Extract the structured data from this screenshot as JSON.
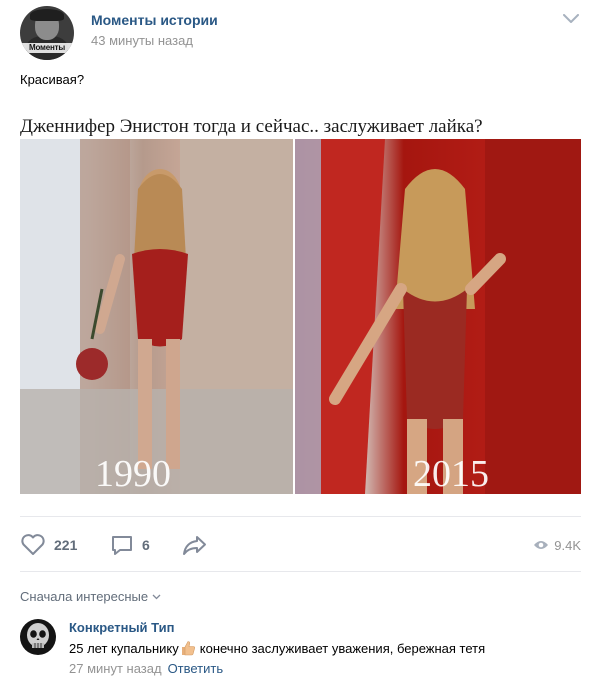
{
  "post": {
    "group_name": "Моменты истории",
    "time": "43 минуты назад",
    "avatar_tag": "Моменты",
    "text": "Красивая?",
    "image": {
      "caption": "Дженнифер Энистон тогда и сейчас.. заслуживает лайка?",
      "left_year": "1990",
      "right_year": "2015"
    },
    "actions": {
      "likes": "221",
      "comments": "6",
      "views": "9.4K"
    },
    "colors": {
      "link": "#2a5885",
      "muted": "#939393",
      "action_icon": "#828a99"
    }
  },
  "comments_section": {
    "sort_label": "Сначала интересные",
    "items": [
      {
        "author": "Конкретный Тип",
        "text_before": "25 лет купальнику",
        "text_after": "конечно заслуживает уважения, бережная тетя",
        "time": "27 минут назад",
        "reply_label": "Ответить"
      }
    ]
  },
  "icons": {
    "more": "chevron-down-icon",
    "like": "heart-icon",
    "comment": "comment-icon",
    "share": "share-arrow-icon",
    "views": "eye-icon",
    "emoji": "thumbs-up-emoji"
  }
}
